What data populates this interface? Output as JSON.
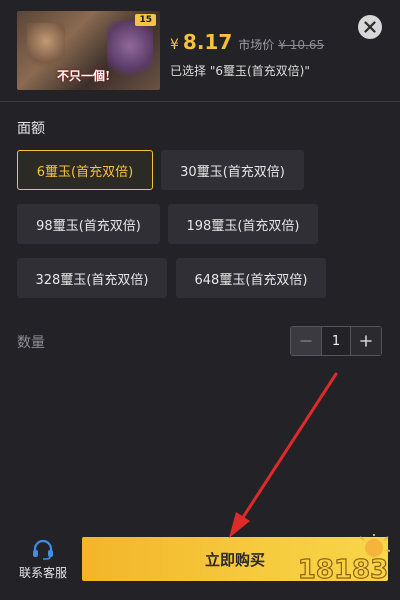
{
  "product": {
    "promo_badge": "15",
    "slogan": "不只一個!",
    "price_symbol": "¥",
    "price": "8.17",
    "market_label": "市场价",
    "market_price": "¥ 10.65",
    "selected_text": "已选择 \"6璽玉(首充双倍)\""
  },
  "denomination": {
    "label": "面额",
    "options": [
      {
        "label": "6璽玉(首充双倍)",
        "selected": true
      },
      {
        "label": "30璽玉(首充双倍)",
        "selected": false
      },
      {
        "label": "98璽玉(首充双倍)",
        "selected": false
      },
      {
        "label": "198璽玉(首充双倍)",
        "selected": false
      },
      {
        "label": "328璽玉(首充双倍)",
        "selected": false
      },
      {
        "label": "648璽玉(首充双倍)",
        "selected": false
      }
    ]
  },
  "quantity": {
    "label": "数量",
    "value": "1"
  },
  "footer": {
    "service_label": "联系客服",
    "buy_label": "立即购买"
  },
  "watermark": {
    "text": "18183"
  },
  "colors": {
    "accent": "#f5c23a",
    "background": "#232327",
    "annotation_arrow": "#e02a2a"
  },
  "icons": {
    "close": "close-icon",
    "headset": "headset-icon",
    "minus": "minus-icon",
    "plus": "plus-icon"
  }
}
